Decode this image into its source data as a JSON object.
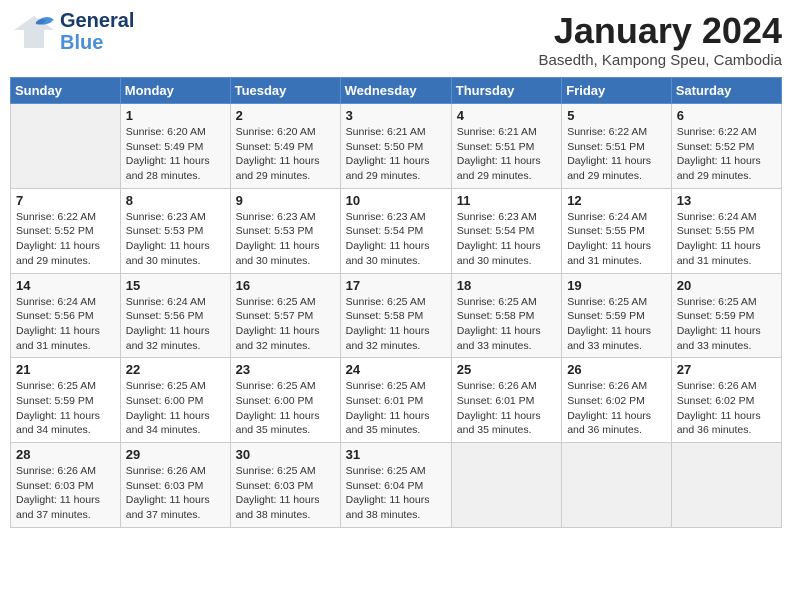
{
  "logo": {
    "general": "General",
    "blue": "Blue"
  },
  "title": "January 2024",
  "location": "Basedth, Kampong Speu, Cambodia",
  "days_header": [
    "Sunday",
    "Monday",
    "Tuesday",
    "Wednesday",
    "Thursday",
    "Friday",
    "Saturday"
  ],
  "weeks": [
    [
      {
        "num": "",
        "sunrise": "",
        "sunset": "",
        "daylight": ""
      },
      {
        "num": "1",
        "sunrise": "Sunrise: 6:20 AM",
        "sunset": "Sunset: 5:49 PM",
        "daylight": "Daylight: 11 hours and 28 minutes."
      },
      {
        "num": "2",
        "sunrise": "Sunrise: 6:20 AM",
        "sunset": "Sunset: 5:49 PM",
        "daylight": "Daylight: 11 hours and 29 minutes."
      },
      {
        "num": "3",
        "sunrise": "Sunrise: 6:21 AM",
        "sunset": "Sunset: 5:50 PM",
        "daylight": "Daylight: 11 hours and 29 minutes."
      },
      {
        "num": "4",
        "sunrise": "Sunrise: 6:21 AM",
        "sunset": "Sunset: 5:51 PM",
        "daylight": "Daylight: 11 hours and 29 minutes."
      },
      {
        "num": "5",
        "sunrise": "Sunrise: 6:22 AM",
        "sunset": "Sunset: 5:51 PM",
        "daylight": "Daylight: 11 hours and 29 minutes."
      },
      {
        "num": "6",
        "sunrise": "Sunrise: 6:22 AM",
        "sunset": "Sunset: 5:52 PM",
        "daylight": "Daylight: 11 hours and 29 minutes."
      }
    ],
    [
      {
        "num": "7",
        "sunrise": "Sunrise: 6:22 AM",
        "sunset": "Sunset: 5:52 PM",
        "daylight": "Daylight: 11 hours and 29 minutes."
      },
      {
        "num": "8",
        "sunrise": "Sunrise: 6:23 AM",
        "sunset": "Sunset: 5:53 PM",
        "daylight": "Daylight: 11 hours and 30 minutes."
      },
      {
        "num": "9",
        "sunrise": "Sunrise: 6:23 AM",
        "sunset": "Sunset: 5:53 PM",
        "daylight": "Daylight: 11 hours and 30 minutes."
      },
      {
        "num": "10",
        "sunrise": "Sunrise: 6:23 AM",
        "sunset": "Sunset: 5:54 PM",
        "daylight": "Daylight: 11 hours and 30 minutes."
      },
      {
        "num": "11",
        "sunrise": "Sunrise: 6:23 AM",
        "sunset": "Sunset: 5:54 PM",
        "daylight": "Daylight: 11 hours and 30 minutes."
      },
      {
        "num": "12",
        "sunrise": "Sunrise: 6:24 AM",
        "sunset": "Sunset: 5:55 PM",
        "daylight": "Daylight: 11 hours and 31 minutes."
      },
      {
        "num": "13",
        "sunrise": "Sunrise: 6:24 AM",
        "sunset": "Sunset: 5:55 PM",
        "daylight": "Daylight: 11 hours and 31 minutes."
      }
    ],
    [
      {
        "num": "14",
        "sunrise": "Sunrise: 6:24 AM",
        "sunset": "Sunset: 5:56 PM",
        "daylight": "Daylight: 11 hours and 31 minutes."
      },
      {
        "num": "15",
        "sunrise": "Sunrise: 6:24 AM",
        "sunset": "Sunset: 5:56 PM",
        "daylight": "Daylight: 11 hours and 32 minutes."
      },
      {
        "num": "16",
        "sunrise": "Sunrise: 6:25 AM",
        "sunset": "Sunset: 5:57 PM",
        "daylight": "Daylight: 11 hours and 32 minutes."
      },
      {
        "num": "17",
        "sunrise": "Sunrise: 6:25 AM",
        "sunset": "Sunset: 5:58 PM",
        "daylight": "Daylight: 11 hours and 32 minutes."
      },
      {
        "num": "18",
        "sunrise": "Sunrise: 6:25 AM",
        "sunset": "Sunset: 5:58 PM",
        "daylight": "Daylight: 11 hours and 33 minutes."
      },
      {
        "num": "19",
        "sunrise": "Sunrise: 6:25 AM",
        "sunset": "Sunset: 5:59 PM",
        "daylight": "Daylight: 11 hours and 33 minutes."
      },
      {
        "num": "20",
        "sunrise": "Sunrise: 6:25 AM",
        "sunset": "Sunset: 5:59 PM",
        "daylight": "Daylight: 11 hours and 33 minutes."
      }
    ],
    [
      {
        "num": "21",
        "sunrise": "Sunrise: 6:25 AM",
        "sunset": "Sunset: 5:59 PM",
        "daylight": "Daylight: 11 hours and 34 minutes."
      },
      {
        "num": "22",
        "sunrise": "Sunrise: 6:25 AM",
        "sunset": "Sunset: 6:00 PM",
        "daylight": "Daylight: 11 hours and 34 minutes."
      },
      {
        "num": "23",
        "sunrise": "Sunrise: 6:25 AM",
        "sunset": "Sunset: 6:00 PM",
        "daylight": "Daylight: 11 hours and 35 minutes."
      },
      {
        "num": "24",
        "sunrise": "Sunrise: 6:25 AM",
        "sunset": "Sunset: 6:01 PM",
        "daylight": "Daylight: 11 hours and 35 minutes."
      },
      {
        "num": "25",
        "sunrise": "Sunrise: 6:26 AM",
        "sunset": "Sunset: 6:01 PM",
        "daylight": "Daylight: 11 hours and 35 minutes."
      },
      {
        "num": "26",
        "sunrise": "Sunrise: 6:26 AM",
        "sunset": "Sunset: 6:02 PM",
        "daylight": "Daylight: 11 hours and 36 minutes."
      },
      {
        "num": "27",
        "sunrise": "Sunrise: 6:26 AM",
        "sunset": "Sunset: 6:02 PM",
        "daylight": "Daylight: 11 hours and 36 minutes."
      }
    ],
    [
      {
        "num": "28",
        "sunrise": "Sunrise: 6:26 AM",
        "sunset": "Sunset: 6:03 PM",
        "daylight": "Daylight: 11 hours and 37 minutes."
      },
      {
        "num": "29",
        "sunrise": "Sunrise: 6:26 AM",
        "sunset": "Sunset: 6:03 PM",
        "daylight": "Daylight: 11 hours and 37 minutes."
      },
      {
        "num": "30",
        "sunrise": "Sunrise: 6:25 AM",
        "sunset": "Sunset: 6:03 PM",
        "daylight": "Daylight: 11 hours and 38 minutes."
      },
      {
        "num": "31",
        "sunrise": "Sunrise: 6:25 AM",
        "sunset": "Sunset: 6:04 PM",
        "daylight": "Daylight: 11 hours and 38 minutes."
      },
      {
        "num": "",
        "sunrise": "",
        "sunset": "",
        "daylight": ""
      },
      {
        "num": "",
        "sunrise": "",
        "sunset": "",
        "daylight": ""
      },
      {
        "num": "",
        "sunrise": "",
        "sunset": "",
        "daylight": ""
      }
    ]
  ]
}
